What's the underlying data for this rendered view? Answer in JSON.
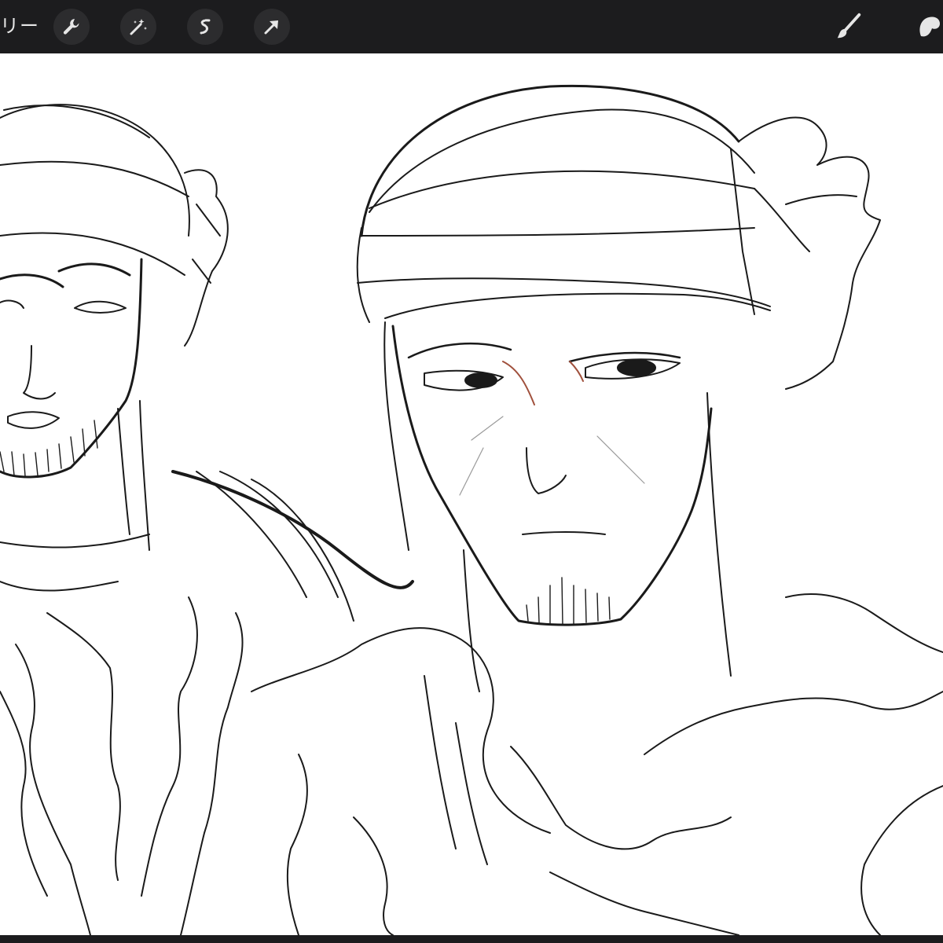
{
  "toolbar": {
    "gallery_label": "リー",
    "tools": [
      {
        "name": "actions",
        "icon": "wrench-icon"
      },
      {
        "name": "adjustments",
        "icon": "magic-wand-icon"
      },
      {
        "name": "selection",
        "icon": "selection-s-icon"
      },
      {
        "name": "transform",
        "icon": "arrow-cursor-icon"
      }
    ],
    "right_tools": [
      {
        "name": "brush",
        "icon": "brush-icon"
      },
      {
        "name": "smudge",
        "icon": "smudge-finger-icon"
      }
    ]
  },
  "colors": {
    "toolbar_bg": "#1c1c1e",
    "button_bg": "#2c2c2e",
    "icon": "#e6e6e6",
    "canvas": "#ffffff",
    "ink": "#1a1a1a",
    "accent_stroke": "#a0503c"
  },
  "canvas": {
    "content": "sketch-artwork"
  }
}
